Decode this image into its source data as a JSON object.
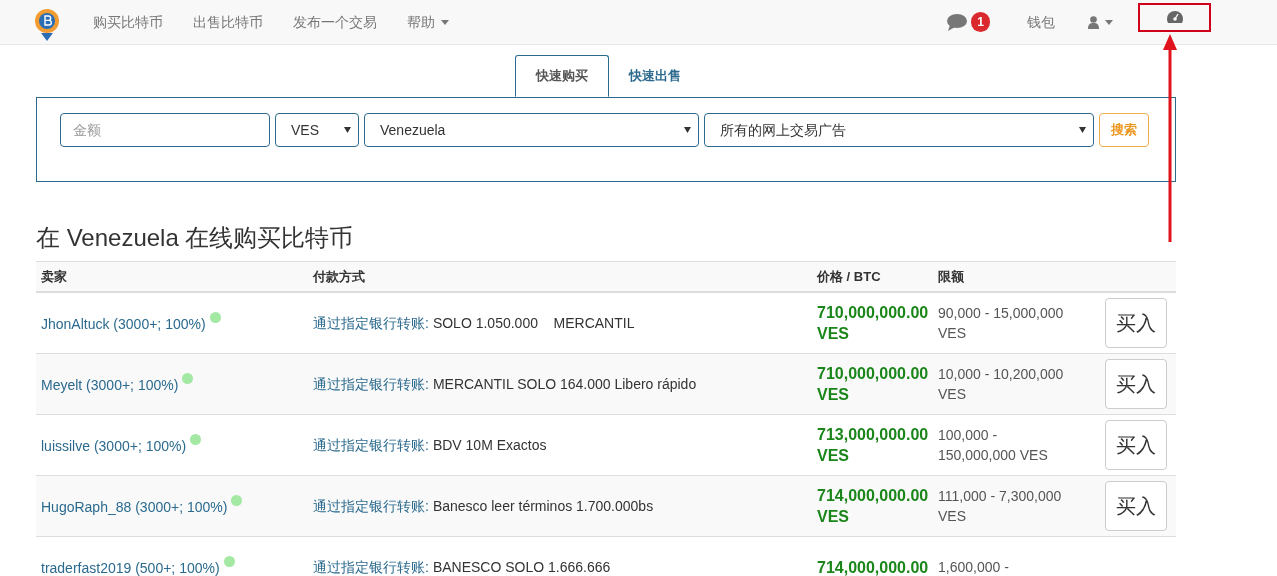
{
  "navbar": {
    "links": [
      {
        "label": "购买比特币",
        "dropdown": false
      },
      {
        "label": "出售比特币",
        "dropdown": false
      },
      {
        "label": "发布一个交易",
        "dropdown": false
      },
      {
        "label": "帮助",
        "dropdown": true
      }
    ],
    "notifications": "1",
    "wallet": "钱包"
  },
  "search_panel": {
    "tabs": [
      {
        "label": "快速购买",
        "selected": true
      },
      {
        "label": "快速出售",
        "selected": false
      }
    ],
    "amount": {
      "placeholder": "金额"
    },
    "currency": "VES",
    "country": "Venezuela",
    "method": "所有的网上交易广告",
    "search_button": "搜索"
  },
  "heading": "在 Venezuela 在线购买比特币",
  "table": {
    "columns": [
      "卖家",
      "付款方式",
      "价格 / BTC",
      "限额"
    ],
    "rows": [
      {
        "seller": "JhonAltuck (3000+; 100%)",
        "color": "#a3e8a3",
        "method": "通过指定银行转账:",
        "details": "SOLO 1.050.000    MERCANTIL",
        "price": "710,000,000.00",
        "currency": "VES",
        "limit": [
          "90,000 - 15,000,000",
          "VES"
        ],
        "button": "买入"
      },
      {
        "seller": "Meyelt (3000+; 100%)",
        "color": "#a3e8a3",
        "method": "通过指定银行转账:",
        "details": "MERCANTIL SOLO 164.000 Libero rápido",
        "price": "710,000,000.00",
        "currency": "VES",
        "limit": [
          "10,000 - 10,200,000",
          "VES"
        ],
        "button": "买入"
      },
      {
        "seller": "luissilve (3000+; 100%)",
        "color": "#a3e8a3",
        "method": "通过指定银行转账:",
        "details": "BDV 10M Exactos",
        "price": "713,000,000.00",
        "currency": "VES",
        "limit": [
          "100,000 -",
          "150,000,000 VES"
        ],
        "button": "买入"
      },
      {
        "seller": "HugoRaph_88 (3000+; 100%)",
        "color": "#a3e8a3",
        "method": "通过指定银行转账:",
        "details": "Banesco leer términos 1.700.000bs",
        "price": "714,000,000.00",
        "currency": "VES",
        "limit": [
          "111,000 - 7,300,000",
          "VES"
        ],
        "button": "买入"
      },
      {
        "seller": "traderfast2019 (500+; 100%)",
        "color": "#a3e8a3",
        "method": "通过指定银行转账:",
        "details": "BANESCO SOLO 1.666.666",
        "price": "714,000,000.00",
        "limit": [
          "1,600,000 -"
        ]
      }
    ]
  }
}
